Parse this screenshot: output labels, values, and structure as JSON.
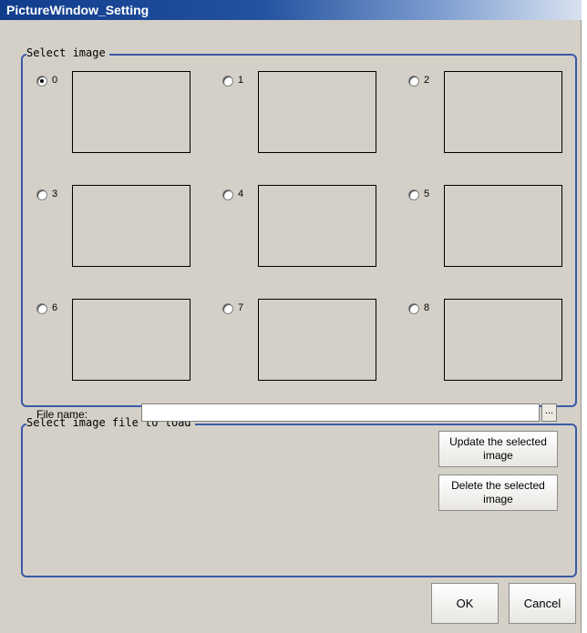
{
  "window": {
    "title": "PictureWindow_Setting"
  },
  "select_image": {
    "label": "Select image",
    "selected_index": 0,
    "options": [
      {
        "label": "0",
        "checked": true
      },
      {
        "label": "1",
        "checked": false
      },
      {
        "label": "2",
        "checked": false
      },
      {
        "label": "3",
        "checked": false
      },
      {
        "label": "4",
        "checked": false
      },
      {
        "label": "5",
        "checked": false
      },
      {
        "label": "6",
        "checked": false
      },
      {
        "label": "7",
        "checked": false
      },
      {
        "label": "8",
        "checked": false
      }
    ]
  },
  "load_file": {
    "label": "Select image file to load",
    "file_name_label": "File name:",
    "file_name_value": "",
    "browse_label": "...",
    "update_button": "Update the selected image",
    "delete_button": "Delete the selected image"
  },
  "footer": {
    "ok_label": "OK",
    "cancel_label": "Cancel"
  },
  "colors": {
    "title_bar": "#103c8c",
    "group_border": "#3b59a8",
    "dialog_bg": "#d4d0c8"
  }
}
